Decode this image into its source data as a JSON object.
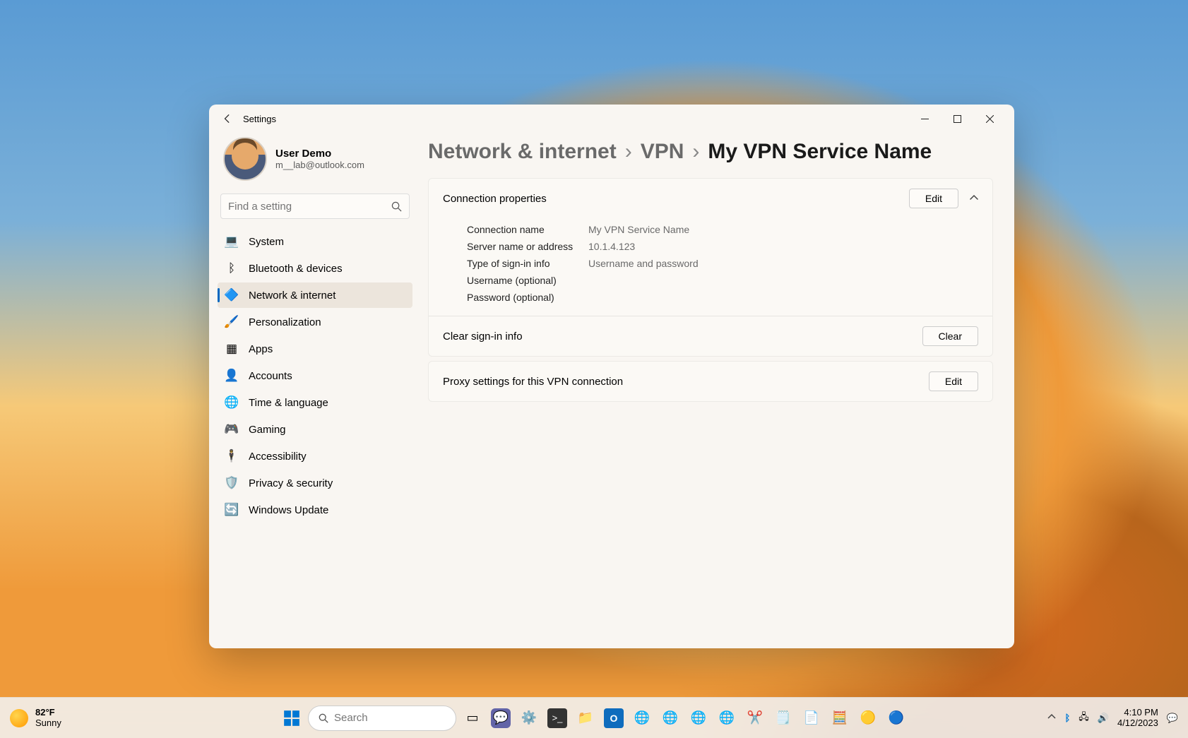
{
  "window": {
    "appTitle": "Settings",
    "user": {
      "name": "User Demo",
      "email": "m__lab@outlook.com"
    },
    "search": {
      "placeholder": "Find a setting"
    },
    "nav": {
      "items": [
        {
          "label": "System",
          "icon": "💻"
        },
        {
          "label": "Bluetooth & devices",
          "icon": "ᛒ"
        },
        {
          "label": "Network & internet",
          "icon": "🔷"
        },
        {
          "label": "Personalization",
          "icon": "🖌️"
        },
        {
          "label": "Apps",
          "icon": "▦"
        },
        {
          "label": "Accounts",
          "icon": "👤"
        },
        {
          "label": "Time & language",
          "icon": "🌐"
        },
        {
          "label": "Gaming",
          "icon": "🎮"
        },
        {
          "label": "Accessibility",
          "icon": "🕴"
        },
        {
          "label": "Privacy & security",
          "icon": "🛡️"
        },
        {
          "label": "Windows Update",
          "icon": "🔄"
        }
      ],
      "activeIndex": 2
    },
    "breadcrumb": {
      "parts": [
        "Network & internet",
        "VPN",
        "My VPN Service Name"
      ]
    },
    "connectionProperties": {
      "header": "Connection properties",
      "editLabel": "Edit",
      "rows": [
        {
          "k": "Connection name",
          "v": "My VPN Service Name"
        },
        {
          "k": "Server name or address",
          "v": "10.1.4.123"
        },
        {
          "k": "Type of sign-in info",
          "v": "Username and password"
        },
        {
          "k": "Username (optional)",
          "v": ""
        },
        {
          "k": "Password (optional)",
          "v": ""
        }
      ],
      "clearSignIn": {
        "label": "Clear sign-in info",
        "button": "Clear"
      }
    },
    "proxy": {
      "label": "Proxy settings for this VPN connection",
      "button": "Edit"
    }
  },
  "taskbar": {
    "weather": {
      "temp": "82°F",
      "condition": "Sunny"
    },
    "search": {
      "placeholder": "Search"
    },
    "time": "4:10 PM",
    "date": "4/12/2023"
  }
}
